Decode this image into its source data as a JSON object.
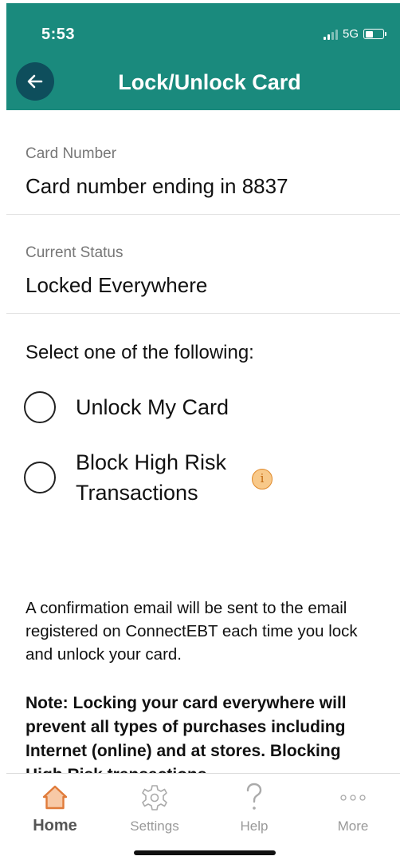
{
  "status_bar": {
    "time": "5:53",
    "network": "5G"
  },
  "header": {
    "title": "Lock/Unlock Card",
    "back_icon": "arrow-left-icon",
    "background_color": "#1a8a7d"
  },
  "card_number": {
    "label": "Card Number",
    "value": "Card number ending in 8837"
  },
  "current_status": {
    "label": "Current Status",
    "value": "Locked Everywhere"
  },
  "selection": {
    "heading": "Select one of the following:",
    "options": [
      {
        "label": "Unlock My Card",
        "selected": false
      },
      {
        "label_line1": "Block High Risk",
        "label_line2": "Transactions",
        "selected": false,
        "info_icon": "info-icon"
      }
    ]
  },
  "info_text": "A confirmation email will be sent to the email registered on ConnectEBT each time you lock and unlock your card.",
  "note_text": "Note: Locking your card everywhere will prevent all types of purchases including Internet (online) and at stores. Blocking High Risk transactions",
  "tabbar": {
    "tabs": [
      {
        "label": "Home",
        "icon": "home-icon",
        "active": true
      },
      {
        "label": "Settings",
        "icon": "gear-icon",
        "active": false
      },
      {
        "label": "Help",
        "icon": "question-icon",
        "active": false
      },
      {
        "label": "More",
        "icon": "more-dots-icon",
        "active": false
      }
    ]
  }
}
